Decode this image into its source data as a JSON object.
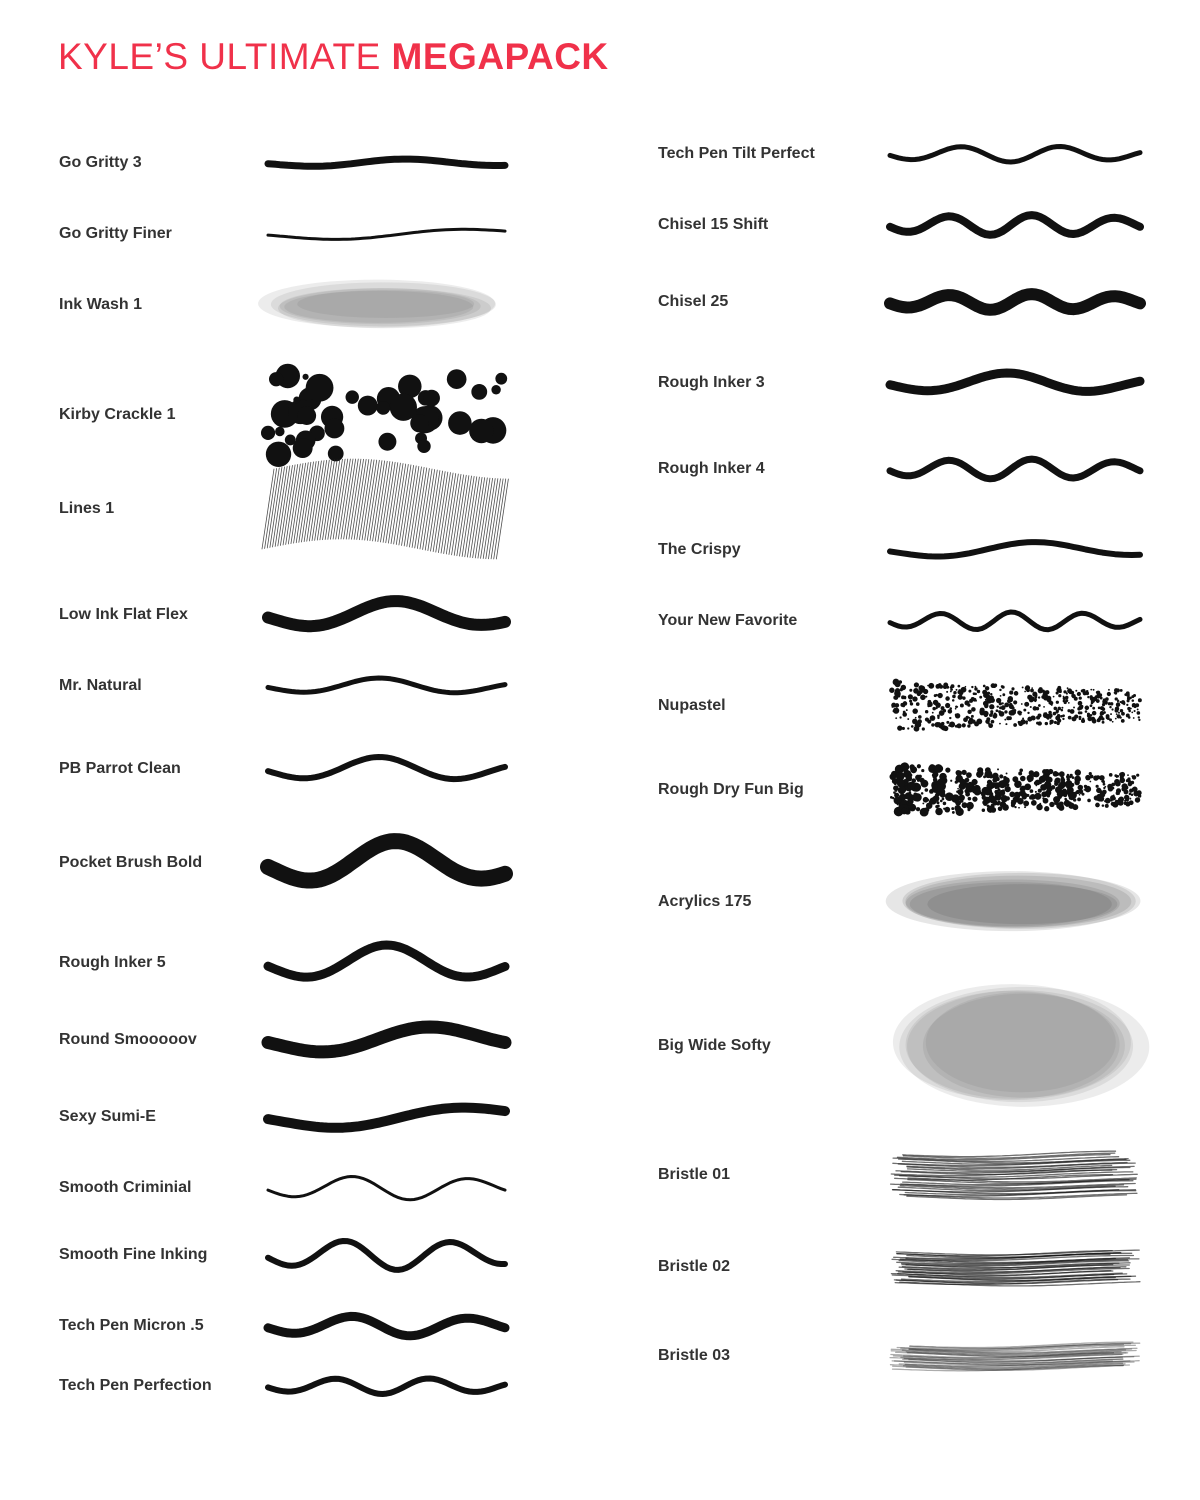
{
  "title": {
    "light": "KYLE’S ULTIMATE",
    "bold": "MEGAPACK",
    "color": "#f0314a"
  },
  "left_column": [
    {
      "name": "Go Gritty 3",
      "style": "gritty"
    },
    {
      "name": "Go Gritty Finer",
      "style": "thin"
    },
    {
      "name": "Ink Wash 1",
      "style": "wash"
    },
    {
      "name": "Kirby Crackle 1",
      "style": "dots"
    },
    {
      "name": "Lines 1",
      "style": "hatch"
    },
    {
      "name": "Low Ink Flat Flex",
      "style": "flat"
    },
    {
      "name": "Mr. Natural",
      "style": "natural"
    },
    {
      "name": "PB Parrot Clean",
      "style": "parrot"
    },
    {
      "name": "Pocket Brush Bold",
      "style": "bold"
    },
    {
      "name": "Rough Inker 5",
      "style": "rough"
    },
    {
      "name": "Round Smooooov",
      "style": "round"
    },
    {
      "name": "Sexy Sumi-E",
      "style": "sumi"
    },
    {
      "name": "Smooth Criminial",
      "style": "criminal"
    },
    {
      "name": "Smooth Fine Inking",
      "style": "fine"
    },
    {
      "name": "Tech Pen Micron .5",
      "style": "micron"
    },
    {
      "name": "Tech Pen Perfection",
      "style": "perfection"
    }
  ],
  "right_column": [
    {
      "name": "Tech Pen Tilt Perfect",
      "style": "tilt"
    },
    {
      "name": "Chisel 15 Shift",
      "style": "chisel15"
    },
    {
      "name": "Chisel 25",
      "style": "chisel25"
    },
    {
      "name": "Rough Inker 3",
      "style": "rough3"
    },
    {
      "name": "Rough Inker 4",
      "style": "rough4"
    },
    {
      "name": "The Crispy",
      "style": "crispy"
    },
    {
      "name": "Your New Favorite",
      "style": "favorite"
    },
    {
      "name": "Nupastel",
      "style": "pastel"
    },
    {
      "name": "Rough Dry Fun Big",
      "style": "dry"
    },
    {
      "name": "Acrylics 175",
      "style": "acrylic"
    },
    {
      "name": "Big Wide Softy",
      "style": "softy"
    },
    {
      "name": "Bristle 01",
      "style": "bristle1"
    },
    {
      "name": "Bristle 02",
      "style": "bristle2"
    },
    {
      "name": "Bristle 03",
      "style": "bristle3"
    }
  ]
}
